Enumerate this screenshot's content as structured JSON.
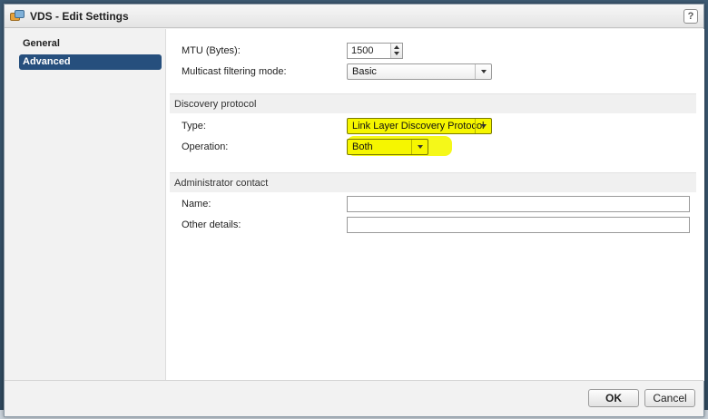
{
  "dialog": {
    "title": "VDS - Edit Settings",
    "help_label": "?"
  },
  "nav": {
    "items": [
      {
        "label": "General",
        "active": false
      },
      {
        "label": "Advanced",
        "active": true
      }
    ]
  },
  "general": {
    "mtu_label": "MTU (Bytes):",
    "mtu_value": "1500",
    "multicast_label": "Multicast filtering mode:",
    "multicast_value": "Basic"
  },
  "discovery": {
    "header": "Discovery protocol",
    "type_label": "Type:",
    "type_value": "Link Layer Discovery Protocol",
    "operation_label": "Operation:",
    "operation_value": "Both"
  },
  "admin": {
    "header": "Administrator contact",
    "name_label": "Name:",
    "name_value": "",
    "other_label": "Other details:",
    "other_value": ""
  },
  "footer": {
    "ok_label": "OK",
    "cancel_label": "Cancel"
  },
  "colors": {
    "nav_active": "#264f7d",
    "highlight": "#f6f600"
  },
  "icons": {
    "title": "distributed-switch-icon",
    "help": "help-icon"
  }
}
